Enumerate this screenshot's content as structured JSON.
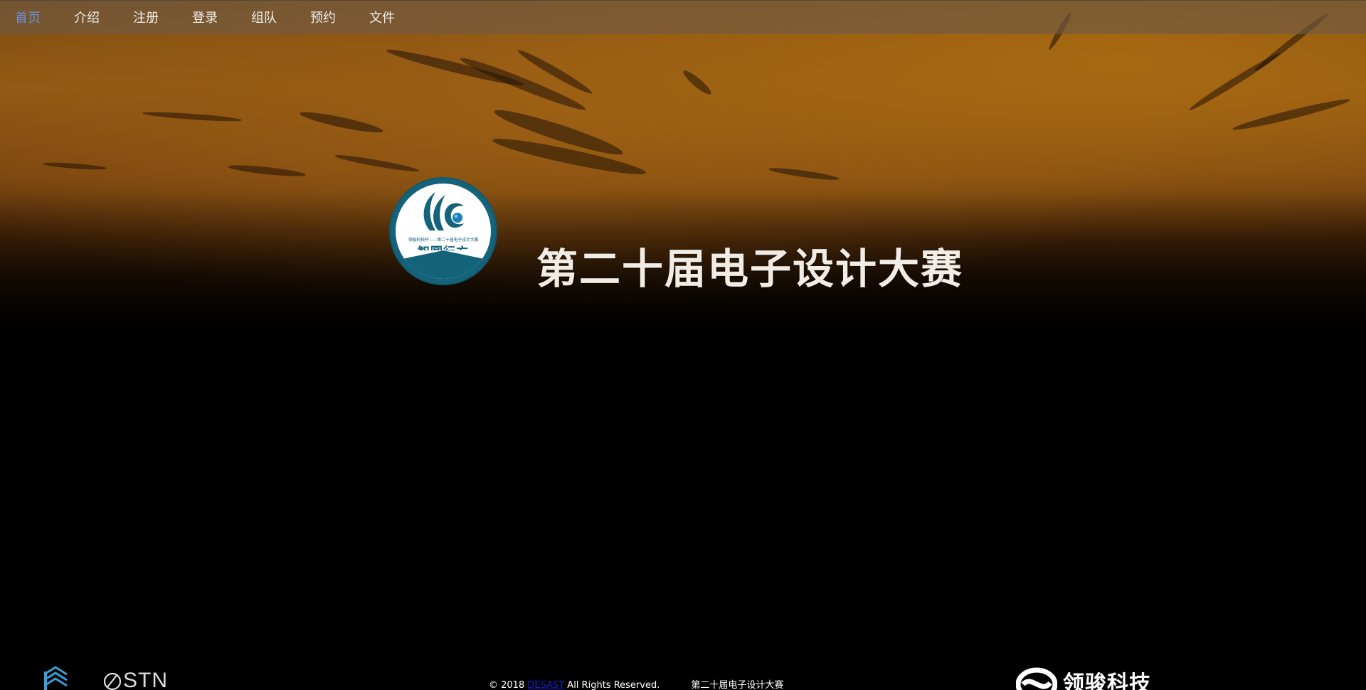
{
  "nav": {
    "items": [
      {
        "label": "首页",
        "active": true
      },
      {
        "label": "介绍",
        "active": false
      },
      {
        "label": "注册",
        "active": false
      },
      {
        "label": "登录",
        "active": false
      },
      {
        "label": "组队",
        "active": false
      },
      {
        "label": "预约",
        "active": false
      },
      {
        "label": "文件",
        "active": false
      }
    ]
  },
  "hero": {
    "title": "第二十届电子设计大赛",
    "emblem": {
      "small_text": "领骏科技杯——第二十届电子设计大赛",
      "big_text": "智圆行方"
    }
  },
  "footer": {
    "copyright_prefix": "© 2018 ",
    "copyright_link": "DESAST",
    "copyright_suffix": " All Rights Reserved.",
    "event_name": "第二十届电子设计大赛",
    "brand_text": "领骏科技",
    "stn_text": "STN"
  },
  "colors": {
    "nav_active": "#6f8fd4",
    "emblem_teal": "#14637a",
    "link_blue": "#1b1bd6"
  }
}
